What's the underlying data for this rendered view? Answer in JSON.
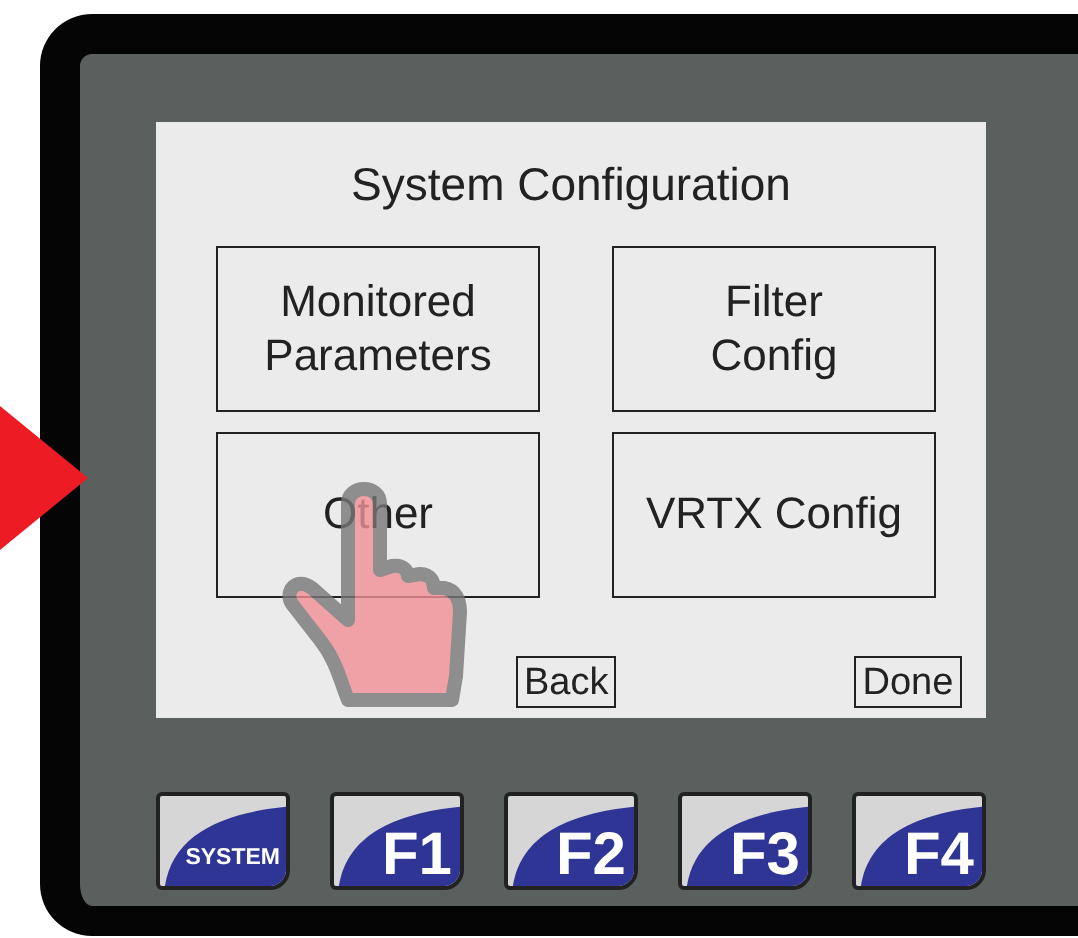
{
  "screen": {
    "title": "System Configuration",
    "options": [
      {
        "label": "Monitored\nParameters"
      },
      {
        "label": "Filter\nConfig"
      },
      {
        "label": "Other"
      },
      {
        "label": "VRTX Config"
      }
    ],
    "nav_buttons": [
      {
        "label": "Back"
      },
      {
        "label": "Done"
      }
    ]
  },
  "keys": [
    {
      "label": "SYSTEM",
      "kind": "system"
    },
    {
      "label": "F1",
      "kind": "function"
    },
    {
      "label": "F2",
      "kind": "function"
    },
    {
      "label": "F3",
      "kind": "function"
    },
    {
      "label": "F4",
      "kind": "function"
    }
  ]
}
